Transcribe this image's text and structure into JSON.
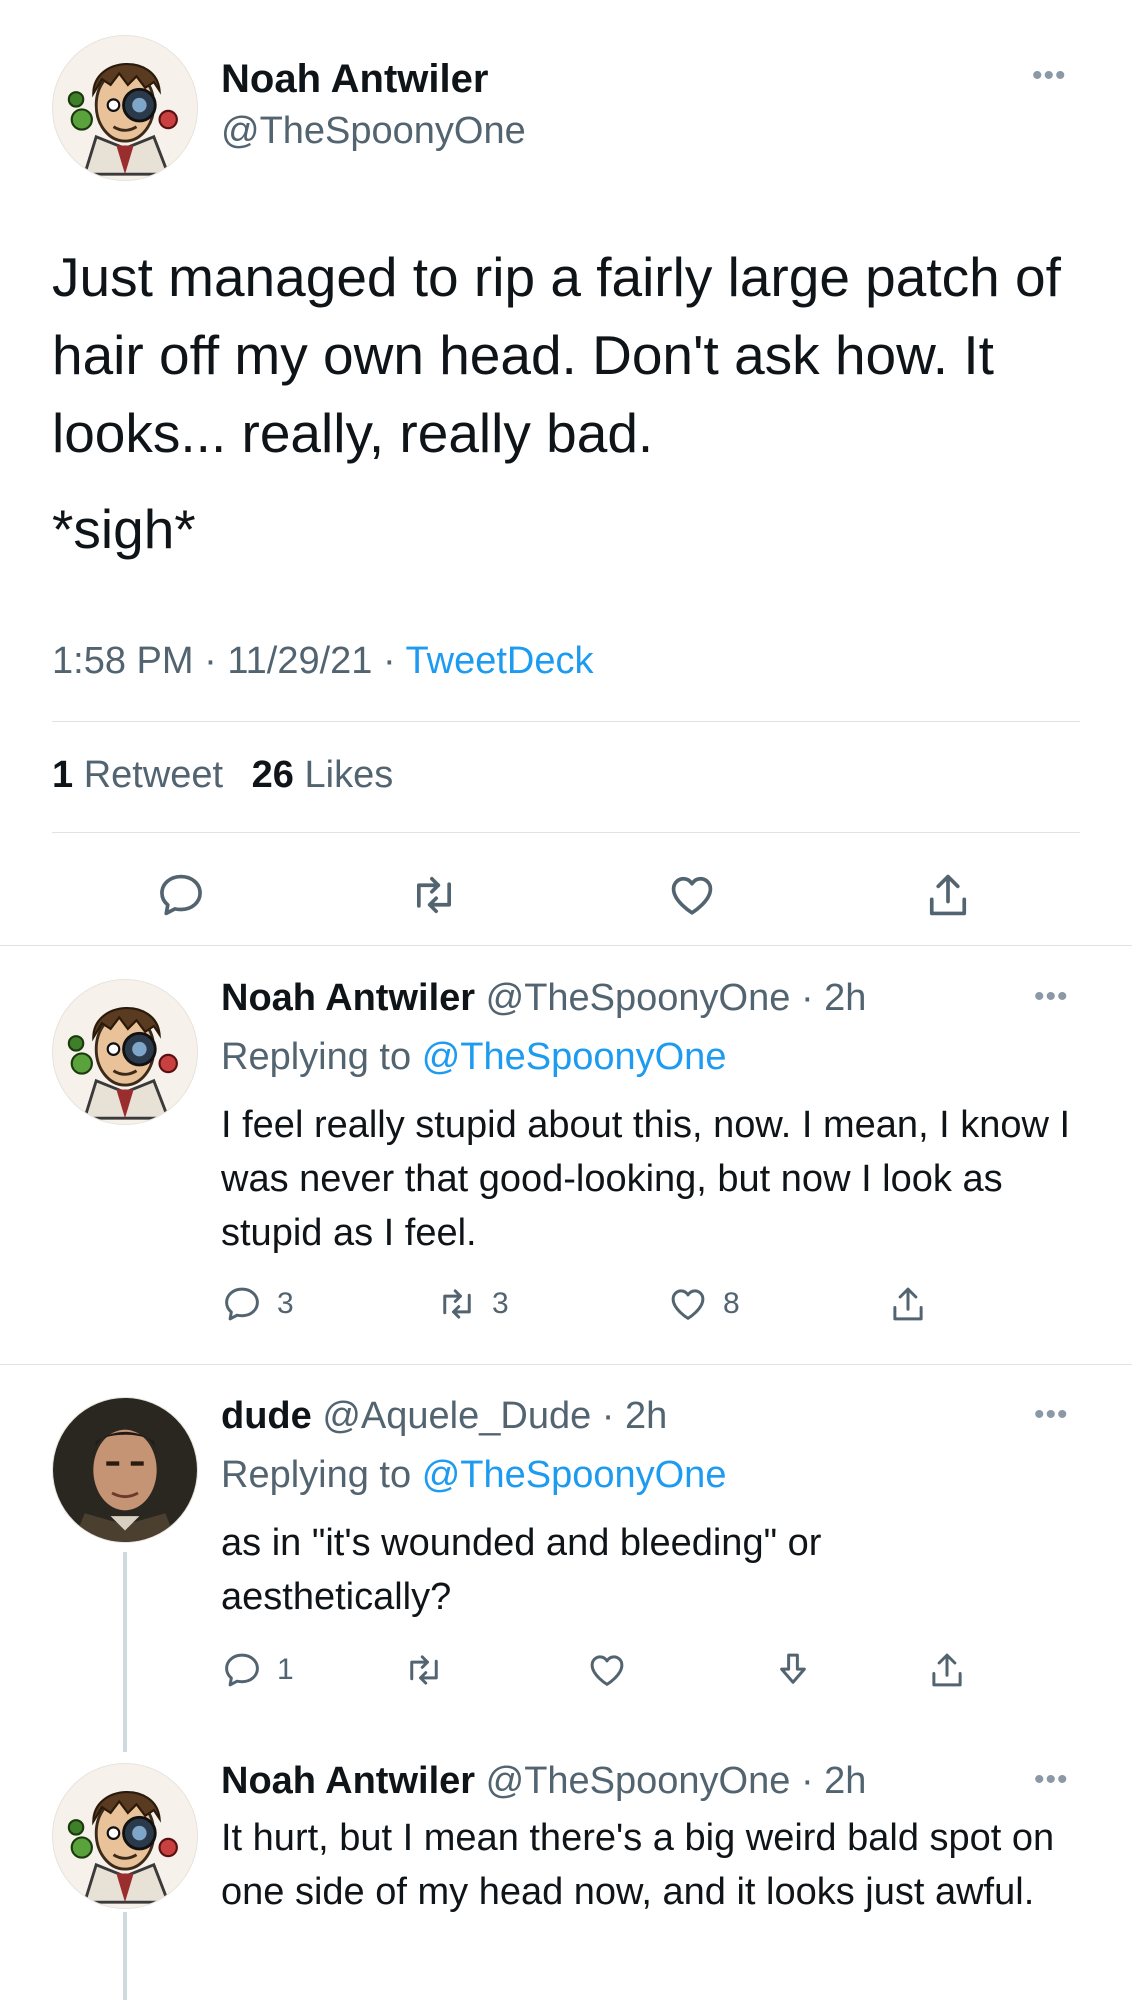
{
  "main_tweet": {
    "author_name": "Noah Antwiler",
    "author_handle": "@TheSpoonyOne",
    "text": "Just managed to rip a fairly large patch of hair off my own head. Don't ask how. It looks... really, really bad.",
    "text2": "*sigh*",
    "time": "1:58 PM",
    "date": "11/29/21",
    "source": "TweetDeck",
    "retweets_count": "1",
    "retweets_label": "Retweet",
    "likes_count": "26",
    "likes_label": "Likes",
    "more_label": "•••"
  },
  "replies": [
    {
      "name": "Noah Antwiler",
      "handle": "@TheSpoonyOne",
      "age": "2h",
      "replying_prefix": "Replying to",
      "replying_to": "@TheSpoonyOne",
      "text": "I feel really stupid about this, now. I mean, I know I was never that good-looking, but now I look as stupid as I feel.",
      "reply_count": "3",
      "retweet_count": "3",
      "like_count": "8"
    },
    {
      "name": "dude",
      "handle": "@Aquele_Dude",
      "age": "2h",
      "replying_prefix": "Replying to",
      "replying_to": "@TheSpoonyOne",
      "text": "as in \"it's wounded and bleeding\" or aesthetically?",
      "reply_count": "1"
    },
    {
      "name": "Noah Antwiler",
      "handle": "@TheSpoonyOne",
      "age": "2h",
      "text": "It hurt, but I mean there's a big weird bald spot on one side of my head now, and it looks just awful."
    }
  ],
  "separator": "·",
  "colors": {
    "link": "#1d9bf0",
    "secondary_text": "#536471",
    "primary_text": "#0f1419",
    "divider": "#dfe3e6"
  },
  "icons": [
    "reply-icon",
    "retweet-icon",
    "like-icon",
    "share-icon",
    "download-icon",
    "more-icon"
  ]
}
